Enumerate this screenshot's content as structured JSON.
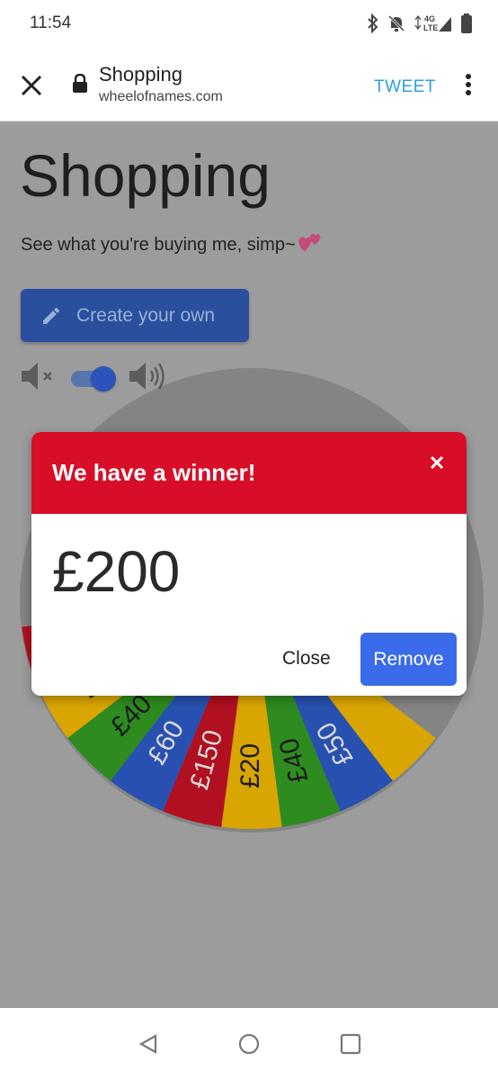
{
  "status_bar": {
    "time": "11:54",
    "network_label": "4G LTE"
  },
  "browser": {
    "page_title": "Shopping",
    "url": "wheelofnames.com",
    "tweet_label": "TWEET"
  },
  "page": {
    "heading": "Shopping",
    "subtitle": "See what you're buying me, simp~",
    "create_button_label": "Create your own",
    "sound_enabled": true
  },
  "wheel": {
    "visible_segments": [
      {
        "label": "£20",
        "color": "#d9a500"
      },
      {
        "label": "£40",
        "color": "#2e8b1f"
      },
      {
        "label": "£60",
        "color": "#2750b0"
      },
      {
        "label": "£150",
        "color": "#b01020"
      },
      {
        "label": "£20",
        "color": "#d9a500"
      },
      {
        "label": "£40",
        "color": "#2e8b1f"
      },
      {
        "label": "£50",
        "color": "#2750b0"
      }
    ]
  },
  "modal": {
    "title": "We have a winner!",
    "winner": "£200",
    "close_label": "Close",
    "remove_label": "Remove",
    "header_color": "#d80e28",
    "remove_color": "#3a6bea"
  },
  "colors": {
    "tweet": "#2aa0e0",
    "create_button": "#2a4f9c"
  }
}
